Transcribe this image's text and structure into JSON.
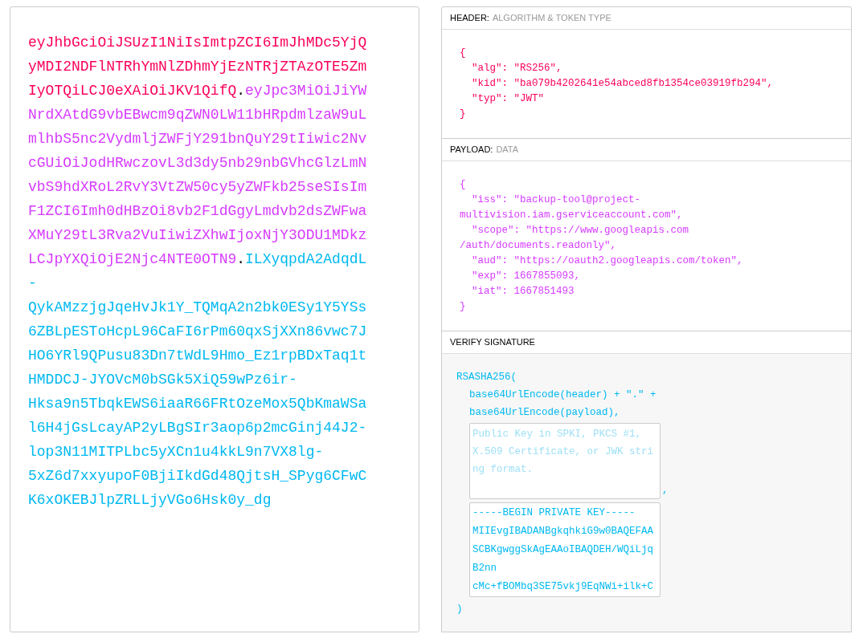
{
  "encoded": {
    "lines": [
      [
        {
          "kind": "header",
          "text": "eyJhbGciOiJSUzI1NiIsImtpZCI6ImJhMDc5YjQ"
        }
      ],
      [
        {
          "kind": "header",
          "text": "yMDI2NDFlNTRhYmNlZDhmYjEzNTRjZTAzOTE5Zm"
        }
      ],
      [
        {
          "kind": "header",
          "text": "IyOTQiLCJ0eXAiOiJKV1QifQ"
        },
        {
          "kind": "separator",
          "text": "."
        },
        {
          "kind": "payload",
          "text": "eyJpc3MiOiJiYW"
        }
      ],
      [
        {
          "kind": "payload",
          "text": "NrdXAtdG9vbEBwcm9qZWN0LW11bHRpdmlzaW9uL"
        }
      ],
      [
        {
          "kind": "payload",
          "text": "mlhbS5nc2VydmljZWFjY291bnQuY29tIiwic2Nv"
        }
      ],
      [
        {
          "kind": "payload",
          "text": "cGUiOiJodHRwczovL3d3dy5nb29nbGVhcGlzLmN"
        }
      ],
      [
        {
          "kind": "payload",
          "text": "vbS9hdXRoL2RvY3VtZW50cy5yZWFkb25seSIsIm"
        }
      ],
      [
        {
          "kind": "payload",
          "text": "F1ZCI6Imh0dHBzOi8vb2F1dGgyLmdvb2dsZWFwa"
        }
      ],
      [
        {
          "kind": "payload",
          "text": "XMuY29tL3Rva2VuIiwiZXhwIjoxNjY3ODU1MDkz"
        }
      ],
      [
        {
          "kind": "payload",
          "text": "LCJpYXQiOjE2Njc4NTE0OTN9"
        },
        {
          "kind": "separator",
          "text": "."
        },
        {
          "kind": "signature",
          "text": "ILXyqpdA2AdqdL"
        }
      ],
      [
        {
          "kind": "signature",
          "text": "-"
        }
      ],
      [
        {
          "kind": "signature",
          "text": "QykAMzzjgJqeHvJk1Y_TQMqA2n2bk0ESy1Y5YSs"
        }
      ],
      [
        {
          "kind": "signature",
          "text": "6ZBLpESToHcpL96CaFI6rPm60qxSjXXn86vwc7J"
        }
      ],
      [
        {
          "kind": "signature",
          "text": "HO6YRl9QPusu83Dn7tWdL9Hmo_Ez1rpBDxTaq1t"
        }
      ],
      [
        {
          "kind": "signature",
          "text": "HMDDCJ-JYOVcM0bSGk5XiQ59wPz6ir-"
        }
      ],
      [
        {
          "kind": "signature",
          "text": "Hksa9n5TbqkEWS6iaaR66FRtOzeMox5QbKmaWSa"
        }
      ],
      [
        {
          "kind": "signature",
          "text": "l6H4jGsLcayAP2yLBgSIr3aop6p2mcGinj44J2-"
        }
      ],
      [
        {
          "kind": "signature",
          "text": "lop3N11MITPLbc5yXCn1u4kkL9n7VX8lg-"
        }
      ],
      [
        {
          "kind": "signature",
          "text": "5xZ6d7xxyupoF0BjiIkdGd48QjtsH_SPyg6CFwC"
        }
      ],
      [
        {
          "kind": "signature",
          "text": "K6xOKEBJlpZRLLjyVGo6Hsk0y_dg"
        }
      ]
    ]
  },
  "header": {
    "title": "HEADER:",
    "subtitle": "ALGORITHM & TOKEN TYPE",
    "lines": [
      "{",
      "  \"alg\": \"RS256\",",
      "  \"kid\": \"ba079b4202641e54abced8fb1354ce03919fb294\",",
      "  \"typ\": \"JWT\"",
      "}"
    ]
  },
  "payload": {
    "title": "PAYLOAD:",
    "subtitle": "DATA",
    "lines": [
      "{",
      "  \"iss\": \"backup-tool@project-",
      "multivision.iam.gserviceaccount.com\",",
      "  \"scope\": \"https://www.googleapis.com",
      "/auth/documents.readonly\",",
      "  \"aud\": \"https://oauth2.googleapis.com/token\",",
      "  \"exp\": 1667855093,",
      "  \"iat\": 1667851493",
      "}"
    ]
  },
  "verify": {
    "title": "VERIFY SIGNATURE",
    "open": "RSASHA256(",
    "args": [
      "base64UrlEncode(header) + \".\" +",
      "base64UrlEncode(payload),"
    ],
    "public_key": {
      "placeholder": "Public Key in SPKI, PKCS #1, X.509 Certificate, or JWK string format."
    },
    "comma": ",",
    "private_key": {
      "value": [
        "-----BEGIN PRIVATE KEY-----",
        "MIIEvgIBADANBgkqhkiG9w0BAQEFAA",
        "SCBKgwggSkAgEAAoIBAQDEH/WQiLjq",
        "B2nn",
        "cMc+fBOMbq3SE75vkj9EqNWi+ilk+C"
      ]
    },
    "close": ")"
  }
}
